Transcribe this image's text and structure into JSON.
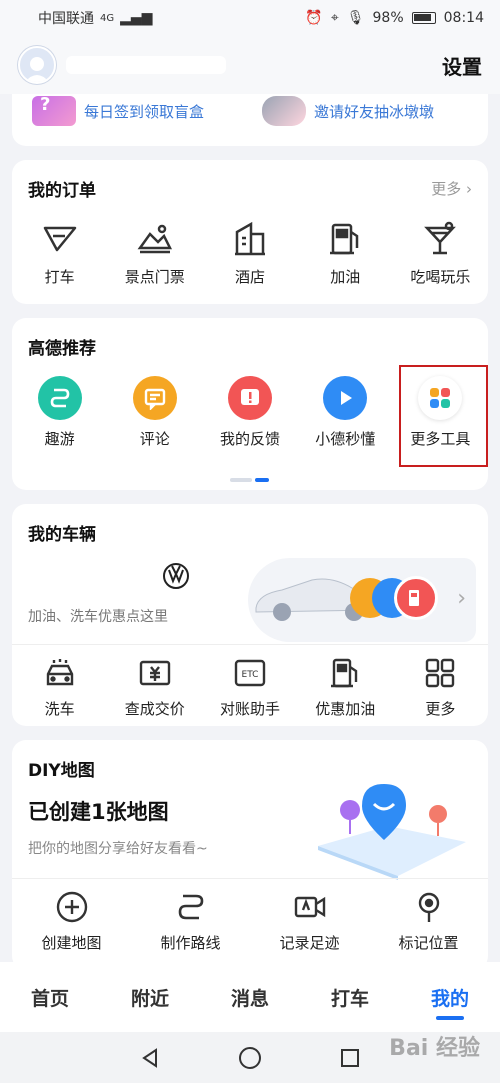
{
  "status_bar": {
    "carrier": "中国联通",
    "network": "4G",
    "battery": "98%",
    "time": "08:14"
  },
  "header": {
    "settings_label": "设置"
  },
  "banner": {
    "item1": "每日签到领取盲盒",
    "item2": "邀请好友抽冰墩墩"
  },
  "orders": {
    "title": "我的订单",
    "more": "更多",
    "items": [
      {
        "label": "打车",
        "icon": "taxi-icon"
      },
      {
        "label": "景点门票",
        "icon": "scenic-ticket-icon"
      },
      {
        "label": "酒店",
        "icon": "hotel-icon"
      },
      {
        "label": "加油",
        "icon": "fuel-icon"
      },
      {
        "label": "吃喝玩乐",
        "icon": "cocktail-icon"
      }
    ]
  },
  "recommend": {
    "title": "高德推荐",
    "items": [
      {
        "label": "趣游",
        "icon": "route-icon",
        "color": "#22c3a6"
      },
      {
        "label": "评论",
        "icon": "comment-icon",
        "color": "#f5a623"
      },
      {
        "label": "我的反馈",
        "icon": "feedback-icon",
        "color": "#f25555"
      },
      {
        "label": "小德秒懂",
        "icon": "play-icon",
        "color": "#2f8cf5"
      },
      {
        "label": "更多工具",
        "icon": "more-tools-icon",
        "color": "#ffffff"
      }
    ]
  },
  "vehicle": {
    "title": "我的车辆",
    "hint": "加油、洗车优惠点这里",
    "items": [
      {
        "label": "洗车",
        "icon": "car-wash-icon"
      },
      {
        "label": "查成交价",
        "icon": "price-tag-icon"
      },
      {
        "label": "对账助手",
        "icon": "etc-icon"
      },
      {
        "label": "优惠加油",
        "icon": "fuel-discount-icon"
      },
      {
        "label": "更多",
        "icon": "grid-icon"
      }
    ]
  },
  "diy": {
    "title": "DIY地图",
    "headline": "已创建1张地图",
    "sub": "把你的地图分享给好友看看~",
    "items": [
      {
        "label": "创建地图",
        "icon": "plus-circle-icon"
      },
      {
        "label": "制作路线",
        "icon": "route-icon"
      },
      {
        "label": "记录足迹",
        "icon": "video-icon"
      },
      {
        "label": "标记位置",
        "icon": "pin-icon"
      }
    ]
  },
  "tabs": [
    {
      "label": "首页"
    },
    {
      "label": "附近"
    },
    {
      "label": "消息"
    },
    {
      "label": "打车"
    },
    {
      "label": "我的"
    }
  ],
  "watermark": "Bai 经验",
  "colors": {
    "accent": "#1a6ff2",
    "highlight": "#c81e1e"
  }
}
